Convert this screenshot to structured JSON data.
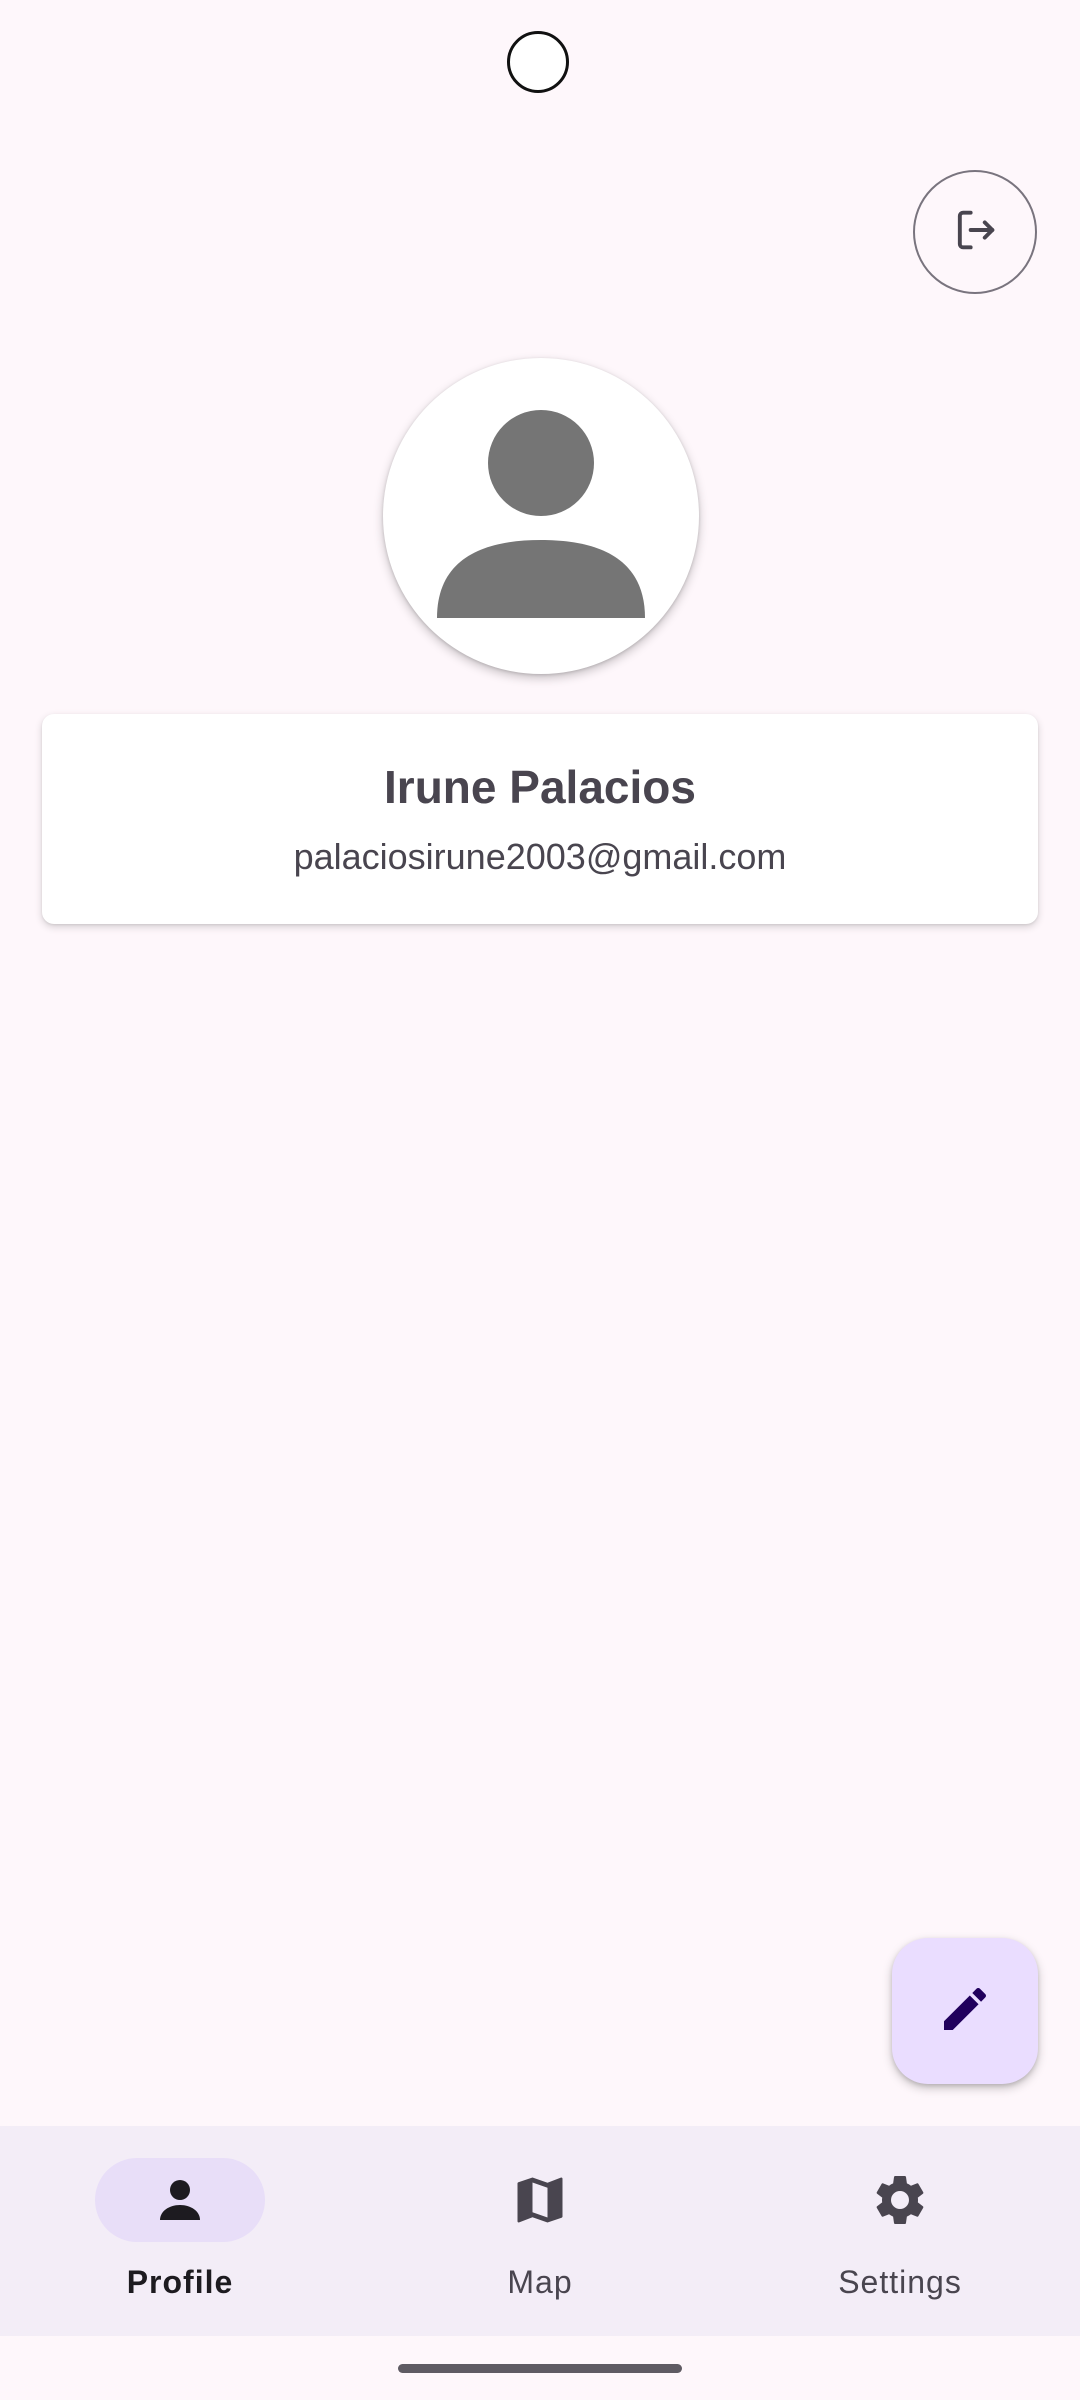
{
  "header": {
    "logout_icon": "logout-icon"
  },
  "profile": {
    "avatar_icon": "person-placeholder-icon",
    "name": "Irune Palacios",
    "email": "palaciosirune2003@gmail.com"
  },
  "fab": {
    "icon": "edit-pencil-icon"
  },
  "bottom_nav": {
    "items": [
      {
        "label": "Profile",
        "icon": "person-icon",
        "selected": true
      },
      {
        "label": "Map",
        "icon": "map-icon",
        "selected": false
      },
      {
        "label": "Settings",
        "icon": "gear-icon",
        "selected": false
      }
    ]
  },
  "colors": {
    "background": "#fef7fb",
    "nav_background": "#f3edf7",
    "nav_indicator": "#e8def8",
    "fab_background": "#eaddff",
    "fab_icon": "#21005d",
    "text_primary": "#49454f"
  }
}
